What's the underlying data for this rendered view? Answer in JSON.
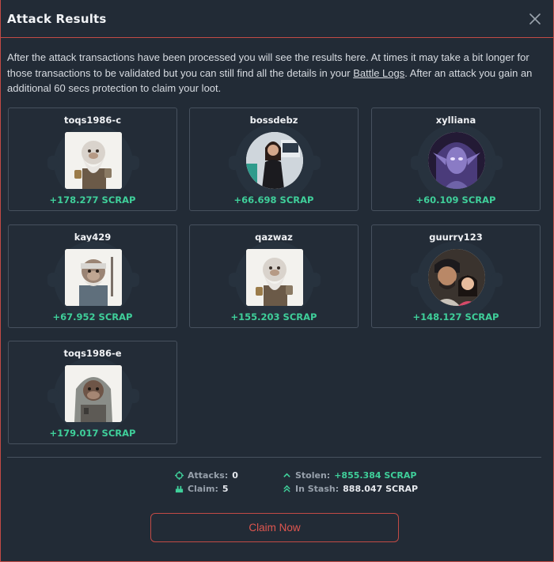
{
  "modal": {
    "title": "Attack Results",
    "intro_before_link": "After the attack transactions have been processed you will see the results here. At times it may take a bit longer for those transactions to be validated but you can still find all the details in your ",
    "intro_link": "Battle Logs",
    "intro_after_link": ". After an attack you gain an additional 60 secs protection to claim your loot."
  },
  "results": [
    {
      "name": "toqs1986-c",
      "amount": "+178.277 SCRAP",
      "avatar": "monkey-wizard"
    },
    {
      "name": "bossdebz",
      "amount": "+66.698 SCRAP",
      "avatar": "woman-photo"
    },
    {
      "name": "xylliana",
      "amount": "+60.109 SCRAP",
      "avatar": "elf-portrait"
    },
    {
      "name": "kay429",
      "amount": "+67.952 SCRAP",
      "avatar": "monkey-bandana"
    },
    {
      "name": "qazwaz",
      "amount": "+155.203 SCRAP",
      "avatar": "monkey-wizard"
    },
    {
      "name": "guurry123",
      "amount": "+148.127 SCRAP",
      "avatar": "family-photo"
    },
    {
      "name": "toqs1986-e",
      "amount": "+179.017 SCRAP",
      "avatar": "monkey-hood"
    }
  ],
  "stats": {
    "attacks_label": "Attacks:",
    "attacks_value": "0",
    "claim_label": "Claim:",
    "claim_value": "5",
    "stolen_label": "Stolen:",
    "stolen_value": "+855.384 SCRAP",
    "stash_label": "In Stash:",
    "stash_value": "888.047 SCRAP"
  },
  "claim_button": "Claim Now",
  "colors": {
    "accent": "#c24a45",
    "positive": "#3fcf9a",
    "background": "#222b36"
  }
}
